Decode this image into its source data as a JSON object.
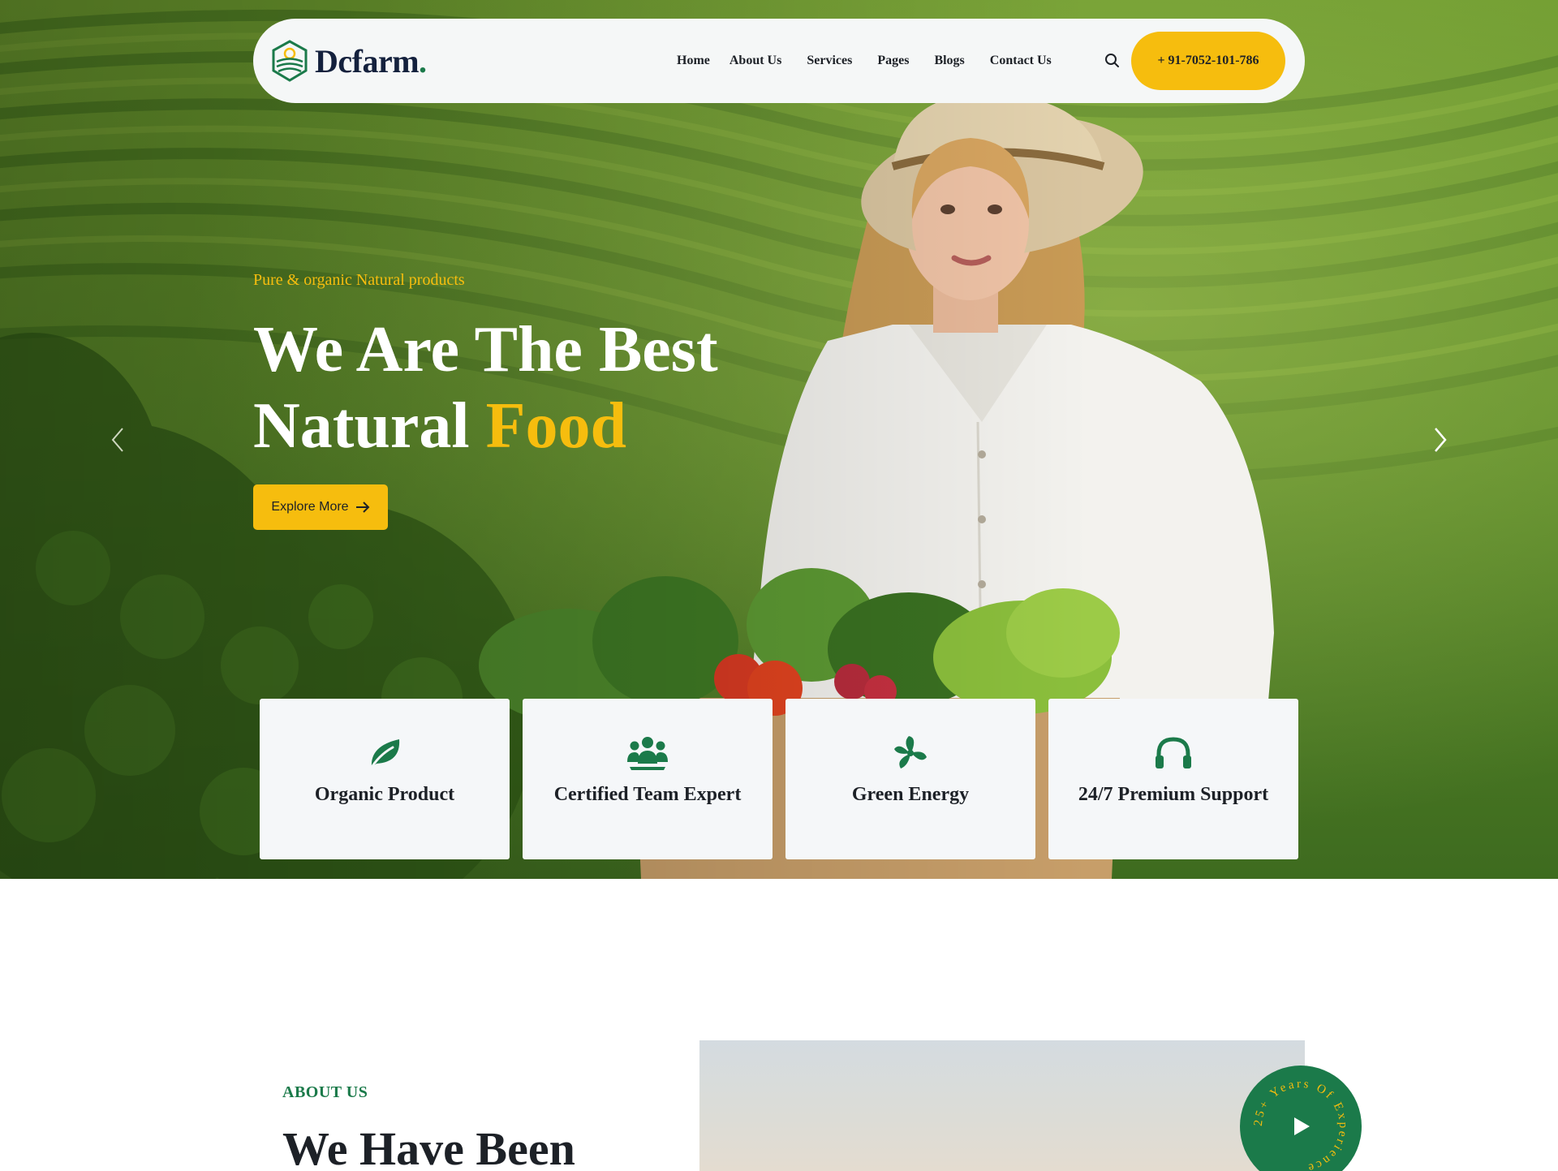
{
  "brand": {
    "name": "Dcfarm",
    "dot": "."
  },
  "nav": {
    "links": [
      "Home",
      "About Us",
      "Services",
      "Pages",
      "Blogs",
      "Contact Us"
    ],
    "phone": "+ 91-7052-101-786"
  },
  "hero": {
    "subtitle": "Pure & organic Natural products",
    "title_line1": "We Are The Best",
    "title_line2": "Natural",
    "title_accent": "Food",
    "cta": "Explore More"
  },
  "features": [
    {
      "icon": "leaf-icon",
      "label": "Organic Product"
    },
    {
      "icon": "team-icon",
      "label": "Certified Team Expert"
    },
    {
      "icon": "fan-icon",
      "label": "Green Energy"
    },
    {
      "icon": "headphones-icon",
      "label": "24/7 Premium Support"
    }
  ],
  "about": {
    "eyebrow": "ABOUT US",
    "title": "We Have Been",
    "badge_text": "25+ Years Of Experience"
  },
  "colors": {
    "accent": "#f6bd0e",
    "brand_green": "#1b7a4a",
    "dark": "#1d2127",
    "card_bg": "#f5f7f9"
  }
}
